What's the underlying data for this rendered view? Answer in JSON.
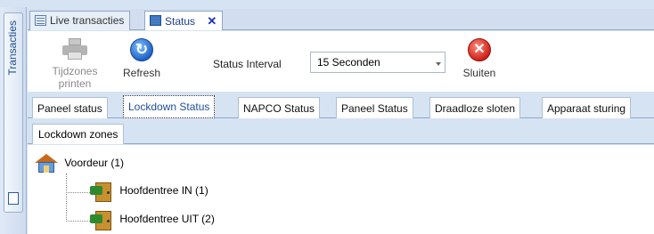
{
  "sidebar": {
    "tab_label": "Transacties",
    "icon": "window-icon"
  },
  "document_tabs": [
    {
      "label": "Live transacties",
      "icon": "list-icon"
    },
    {
      "label": "Status",
      "icon": "status-icon",
      "close": "✕"
    }
  ],
  "toolbar": {
    "print_label": "Tijdzones printen",
    "refresh_label": "Refresh",
    "interval_label": "Status Interval",
    "interval_value": "15 Seconden",
    "close_label": "Sluiten"
  },
  "status_tabs": [
    "Paneel status",
    "Lockdown Status",
    "NAPCO Status",
    "Paneel Status",
    "Draadloze sloten",
    "Apparaat sturing"
  ],
  "active_status_tab": "Lockdown Status",
  "sub_tabs": [
    "Lockdown zones"
  ],
  "tree": {
    "root": "Voordeur (1)",
    "children": [
      "Hoofdentree IN (1)",
      "Hoofdentree UIT (2)"
    ]
  },
  "colors": {
    "accent": "#1f4f9e",
    "close_tab_x": "#1b2fc0",
    "close_button": "#d0221a",
    "refresh_button": "#1f63c7"
  }
}
